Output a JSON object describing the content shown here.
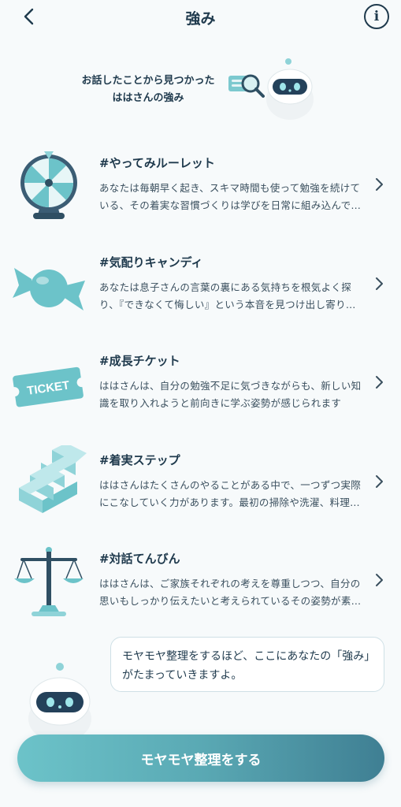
{
  "header": {
    "title": "強み",
    "info_label": "i"
  },
  "hero": {
    "line1": "お話したことから見つかった",
    "line2": "ははさんの強み"
  },
  "strengths": [
    {
      "icon": "roulette-icon",
      "title": "#やってみルーレット",
      "desc": "あなたは毎朝早く起き、スキマ時間も使って勉強を続けている、その着実な習慣づくりは学びを日常に組み込んでいます"
    },
    {
      "icon": "candy-icon",
      "title": "#気配りキャンディ",
      "desc": "あなたは息子さんの言葉の裏にある気持ちを根気よく探り、『できなくて悔しい』という本音を見つけ出し寄り添っています"
    },
    {
      "icon": "ticket-icon",
      "title": "#成長チケット",
      "desc": "ははさんは、自分の勉強不足に気づきながらも、新しい知識を取り入れようと前向きに学ぶ姿勢が感じられます"
    },
    {
      "icon": "stairs-icon",
      "title": "#着実ステップ",
      "desc": "ははさんはたくさんのやることがある中で、一つずつ実際にこなしていく力があります。最初の掃除や洗濯、料理など"
    },
    {
      "icon": "scale-icon",
      "title": "#対話てんびん",
      "desc": "ははさんは、ご家族それぞれの考えを尊重しつつ、自分の思いもしっかり伝えたいと考えられているその姿勢が素敵です"
    }
  ],
  "ticket_text": "TICKET",
  "bubble": {
    "text": "モヤモヤ整理をするほど、ここにあなたの「強み」がたまっていきますよ。"
  },
  "cta": {
    "label": "モヤモヤ整理をする"
  },
  "colors": {
    "accent": "#6cc3c9",
    "dark": "#1f3a4d",
    "cta_end": "#3f7f93"
  }
}
